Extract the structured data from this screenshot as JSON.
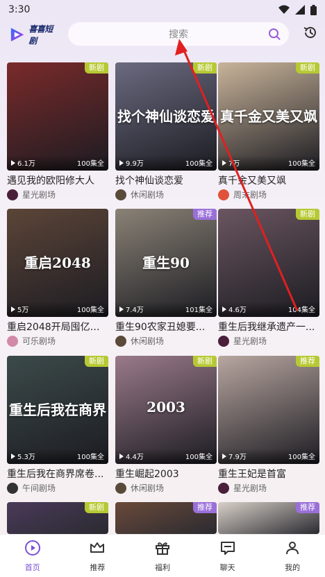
{
  "status": {
    "time": "3:30"
  },
  "header": {
    "logo_text": "喜喜短剧",
    "search_placeholder": "搜索"
  },
  "cards": [
    {
      "title": "遇见我的欧阳修大人",
      "views": "6.1万",
      "episodes": "100集全",
      "badge": "新剧",
      "badge_type": "new",
      "theater": "星光剧场",
      "thumb_color": "#7a2a2a",
      "avatar_color": "#4a1f3a",
      "caption": ""
    },
    {
      "title": "找个神仙谈恋爱",
      "views": "9.9万",
      "episodes": "100集全",
      "badge": "新剧",
      "badge_type": "new",
      "theater": "休闲剧场",
      "thumb_color": "#6b6a80",
      "avatar_color": "#5a4a3a",
      "caption": "找个神仙谈恋爱"
    },
    {
      "title": "真千金又美又飒",
      "views": "7万",
      "episodes": "100集全",
      "badge": "新剧",
      "badge_type": "new",
      "theater": "周末剧场",
      "thumb_color": "#c9b49a",
      "avatar_color": "#e0533a",
      "caption": "真千金又美又飒"
    },
    {
      "title": "重启2048开局囤亿万...",
      "views": "5万",
      "episodes": "100集全",
      "badge": "",
      "badge_type": "",
      "theater": "可乐剧场",
      "thumb_color": "#5c4538",
      "avatar_color": "#d28aa8",
      "caption": "重启2048"
    },
    {
      "title": "重生90农家丑媳要...",
      "views": "7.4万",
      "episodes": "101集全",
      "badge": "推荐",
      "badge_type": "rec",
      "theater": "休闲剧场",
      "thumb_color": "#8a8276",
      "avatar_color": "#5a4a3a",
      "caption": "重生90"
    },
    {
      "title": "重生后我继承遗产一...",
      "views": "4.6万",
      "episodes": "104集全",
      "badge": "新剧",
      "badge_type": "new",
      "theater": "星光剧场",
      "thumb_color": "#6a5560",
      "avatar_color": "#4a1f3a",
      "caption": ""
    },
    {
      "title": "重生后我在商界席卷...",
      "views": "5.3万",
      "episodes": "100集全",
      "badge": "新剧",
      "badge_type": "new",
      "theater": "午间剧场",
      "thumb_color": "#3c4a4a",
      "avatar_color": "#333",
      "caption": "重生后我在商界"
    },
    {
      "title": "重生崛起2003",
      "views": "4.4万",
      "episodes": "100集全",
      "badge": "新剧",
      "badge_type": "new",
      "theater": "休闲剧场",
      "thumb_color": "#9a7a8a",
      "avatar_color": "#5a4a3a",
      "caption": "2003"
    },
    {
      "title": "重生王妃是首富",
      "views": "7.9万",
      "episodes": "100集全",
      "badge": "推荐",
      "badge_type": "new",
      "theater": "星光剧场",
      "thumb_color": "#b8a6a0",
      "avatar_color": "#4a1f3a",
      "caption": ""
    }
  ],
  "peek_badges": [
    "新剧",
    "推荐",
    "推荐"
  ],
  "nav": [
    {
      "label": "首页",
      "icon": "home-play-icon",
      "active": true
    },
    {
      "label": "推荐",
      "icon": "crown-icon",
      "active": false
    },
    {
      "label": "福利",
      "icon": "gift-icon",
      "active": false
    },
    {
      "label": "聊天",
      "icon": "chat-icon",
      "active": false
    },
    {
      "label": "我的",
      "icon": "profile-icon",
      "active": false
    }
  ],
  "colors": {
    "accent": "#7a4fd6",
    "badge_new": "#b7c932",
    "badge_rec": "#9a6fd9",
    "arrow": "#e02020"
  }
}
